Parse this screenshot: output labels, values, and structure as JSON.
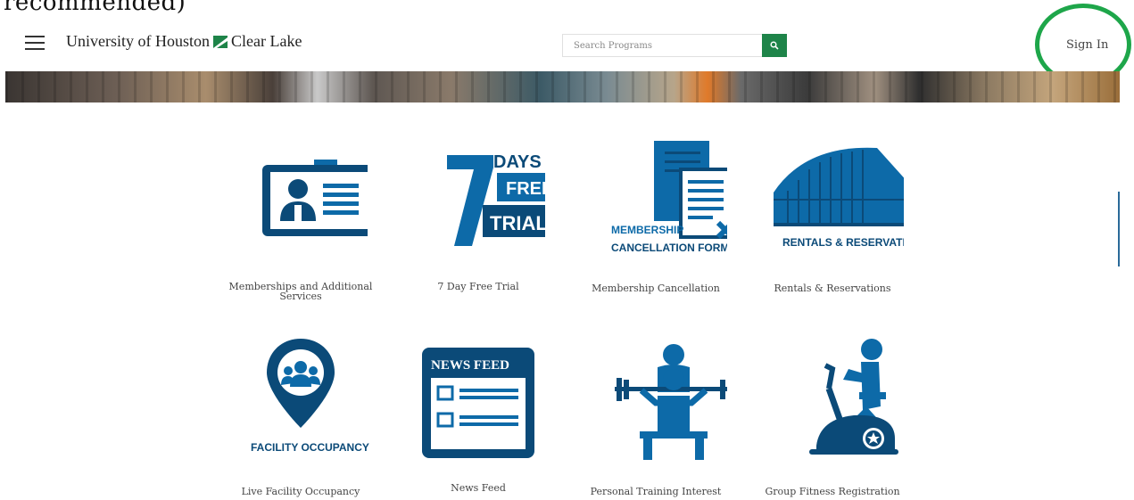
{
  "top_text": "recommended)",
  "header": {
    "brand_left": "University of Houston",
    "brand_right": "Clear Lake",
    "search_placeholder": "Search Programs",
    "sign_in": "Sign In"
  },
  "colors": {
    "brand_green": "#1e8449",
    "icon_blue": "#0d6aa8",
    "icon_navy": "#0b4a78",
    "highlight": "#1ea64a"
  },
  "tiles": [
    {
      "icon": "membership-card-icon",
      "label": "Memberships and Additional Services"
    },
    {
      "icon": "free-trial-icon",
      "label": "7 Day Free Trial",
      "icon_text": [
        "DAYS",
        "FREE",
        "TRIAL",
        "7"
      ]
    },
    {
      "icon": "cancellation-form-icon",
      "label": "Membership Cancellation",
      "icon_text": [
        "MEMBERSHIP",
        "CANCELLATION FORM"
      ]
    },
    {
      "icon": "building-icon",
      "label": "Rentals & Reservations",
      "icon_text": [
        "RENTALS & RESERVATIONS"
      ]
    },
    {
      "icon": "location-pin-icon",
      "label": "Live Facility Occupancy",
      "icon_text": [
        "FACILITY OCCUPANCY"
      ]
    },
    {
      "icon": "news-feed-icon",
      "label": "News Feed",
      "icon_text": [
        "NEWS FEED"
      ]
    },
    {
      "icon": "trainer-icon",
      "label": "Personal Training Interest"
    },
    {
      "icon": "exercise-bike-icon",
      "label": "Group Fitness Registration"
    }
  ]
}
